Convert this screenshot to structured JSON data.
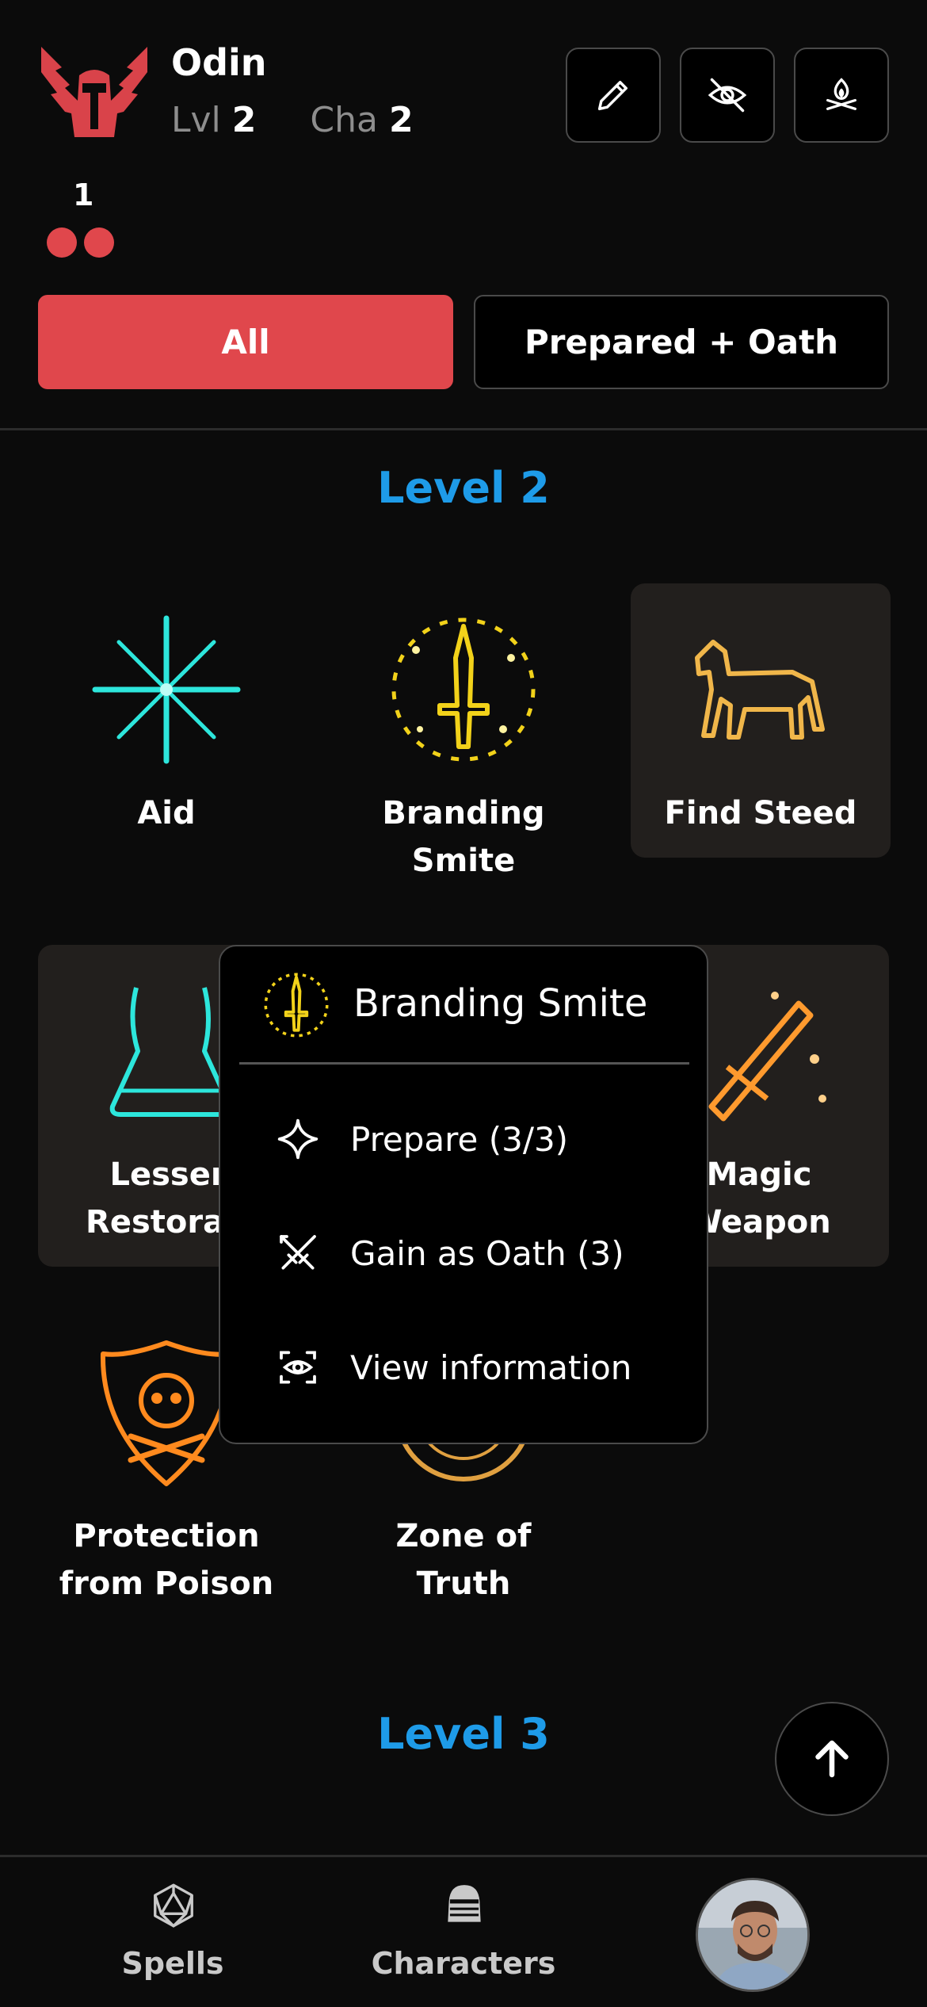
{
  "character": {
    "name": "Odin",
    "level_label": "Lvl",
    "level_value": "2",
    "cha_label": "Cha",
    "cha_value": "2",
    "spell_slot_count": "1",
    "spell_slots_shown": 2
  },
  "header_buttons": [
    {
      "icon": "pencil-icon"
    },
    {
      "icon": "eye-off-icon"
    },
    {
      "icon": "campfire-icon"
    }
  ],
  "filters": {
    "all_label": "All",
    "prepared_label": "Prepared + Oath",
    "active": "All"
  },
  "sections": [
    {
      "title": "Level 2",
      "spells": [
        {
          "name_line1": "Aid",
          "name_line2": "",
          "icon": "aid-icon",
          "color": "#2de6dc"
        },
        {
          "name_line1": "Branding",
          "name_line2": "Smite",
          "icon": "branding-smite-icon",
          "color": "#f2d21a"
        },
        {
          "name_line1": "Find Steed",
          "name_line2": "",
          "icon": "find-steed-icon",
          "color": "#f0b64a",
          "selected": true
        },
        {
          "name_line1": "Lesser",
          "name_line2": "Restorati",
          "icon": "lesser-restoration-icon",
          "color": "#2de6dc"
        },
        {
          "name_line1": "Magic",
          "name_line2": "Weapon",
          "icon": "magic-weapon-icon",
          "color": "#ff9a2e"
        },
        {
          "name_line1": "Protection",
          "name_line2": "from Poison",
          "icon": "protection-from-poison-icon",
          "color": "#ff8a1e"
        },
        {
          "name_line1": "Zone of",
          "name_line2": "Truth",
          "icon": "zone-of-truth-icon",
          "color": "#e0a040"
        }
      ]
    },
    {
      "title": "Level 3"
    }
  ],
  "popup": {
    "title": "Branding Smite",
    "items": [
      {
        "label": "Prepare (3/3)",
        "icon": "sparkle-icon"
      },
      {
        "label": "Gain as Oath (3)",
        "icon": "crossed-swords-icon"
      },
      {
        "label": "View information",
        "icon": "eye-scan-icon"
      }
    ]
  },
  "bottom_nav": {
    "spells_label": "Spells",
    "characters_label": "Characters"
  },
  "colors": {
    "accent_red": "#e0474c",
    "level_blue": "#1e9be8",
    "background": "#0b0b0b"
  }
}
